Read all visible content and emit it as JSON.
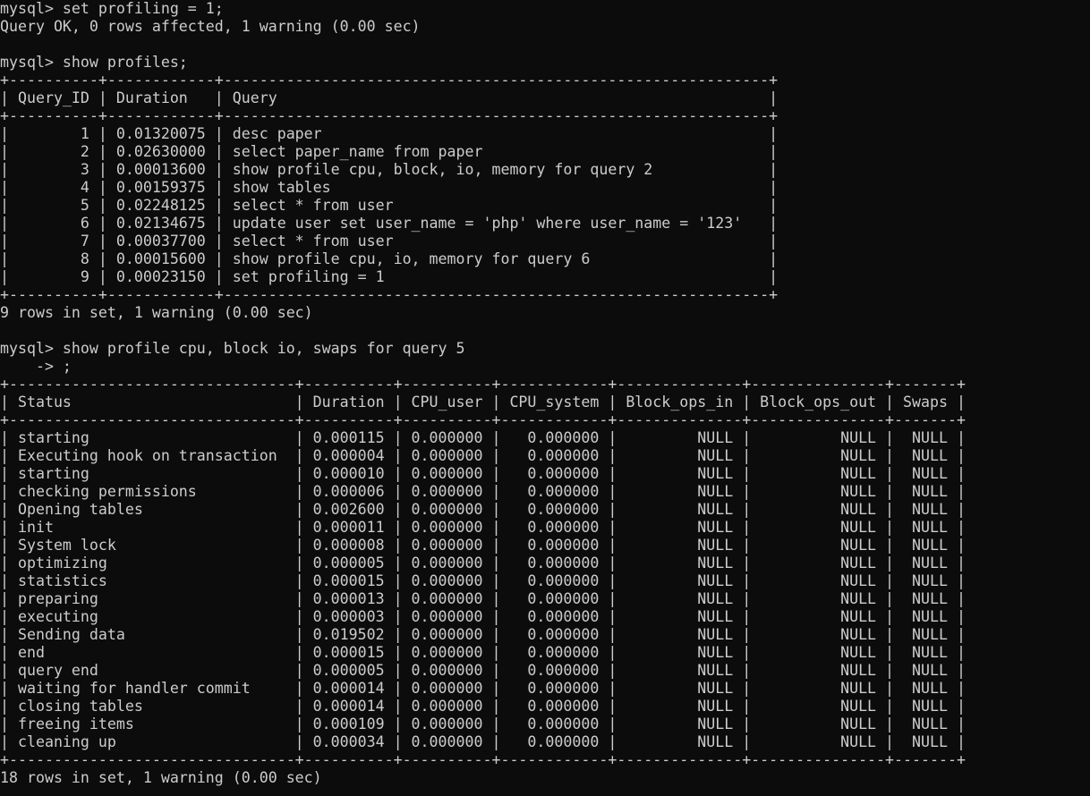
{
  "terminal": {
    "lines": [
      "mysql> set profiling = 1;",
      "Query OK, 0 rows affected, 1 warning (0.00 sec)",
      "",
      "mysql> show profiles;",
      "+----------+------------+-------------------------------------------------------------+",
      "| Query_ID | Duration   | Query                                                       |",
      "+----------+------------+-------------------------------------------------------------+",
      "|        1 | 0.01320075 | desc paper                                                  |",
      "|        2 | 0.02630000 | select paper_name from paper                                |",
      "|        3 | 0.00013600 | show profile cpu, block, io, memory for query 2             |",
      "|        4 | 0.00159375 | show tables                                                 |",
      "|        5 | 0.02248125 | select * from user                                          |",
      "|        6 | 0.02134675 | update user set user_name = 'php' where user_name = '123'   |",
      "|        7 | 0.00037700 | select * from user                                          |",
      "|        8 | 0.00015600 | show profile cpu, io, memory for query 6                    |",
      "|        9 | 0.00023150 | set profiling = 1                                           |",
      "+----------+------------+-------------------------------------------------------------+",
      "9 rows in set, 1 warning (0.00 sec)",
      "",
      "mysql> show profile cpu, block io, swaps for query 5",
      "    -> ;",
      "+--------------------------------+----------+----------+------------+--------------+---------------+-------+",
      "| Status                         | Duration | CPU_user | CPU_system | Block_ops_in | Block_ops_out | Swaps |",
      "+--------------------------------+----------+----------+------------+--------------+---------------+-------+",
      "| starting                       | 0.000115 | 0.000000 |   0.000000 |         NULL |          NULL |  NULL |",
      "| Executing hook on transaction  | 0.000004 | 0.000000 |   0.000000 |         NULL |          NULL |  NULL |",
      "| starting                       | 0.000010 | 0.000000 |   0.000000 |         NULL |          NULL |  NULL |",
      "| checking permissions           | 0.000006 | 0.000000 |   0.000000 |         NULL |          NULL |  NULL |",
      "| Opening tables                 | 0.002600 | 0.000000 |   0.000000 |         NULL |          NULL |  NULL |",
      "| init                           | 0.000011 | 0.000000 |   0.000000 |         NULL |          NULL |  NULL |",
      "| System lock                    | 0.000008 | 0.000000 |   0.000000 |         NULL |          NULL |  NULL |",
      "| optimizing                     | 0.000005 | 0.000000 |   0.000000 |         NULL |          NULL |  NULL |",
      "| statistics                     | 0.000015 | 0.000000 |   0.000000 |         NULL |          NULL |  NULL |",
      "| preparing                      | 0.000013 | 0.000000 |   0.000000 |         NULL |          NULL |  NULL |",
      "| executing                      | 0.000003 | 0.000000 |   0.000000 |         NULL |          NULL |  NULL |",
      "| Sending data                   | 0.019502 | 0.000000 |   0.000000 |         NULL |          NULL |  NULL |",
      "| end                            | 0.000015 | 0.000000 |   0.000000 |         NULL |          NULL |  NULL |",
      "| query end                      | 0.000005 | 0.000000 |   0.000000 |         NULL |          NULL |  NULL |",
      "| waiting for handler commit     | 0.000014 | 0.000000 |   0.000000 |         NULL |          NULL |  NULL |",
      "| closing tables                 | 0.000014 | 0.000000 |   0.000000 |         NULL |          NULL |  NULL |",
      "| freeing items                  | 0.000109 | 0.000000 |   0.000000 |         NULL |          NULL |  NULL |",
      "| cleaning up                    | 0.000034 | 0.000000 |   0.000000 |         NULL |          NULL |  NULL |",
      "+--------------------------------+----------+----------+------------+--------------+---------------+-------+",
      "18 rows in set, 1 warning (0.00 sec)"
    ]
  },
  "colors": {
    "background": "#0c0c0c",
    "text": "#cccccc"
  }
}
